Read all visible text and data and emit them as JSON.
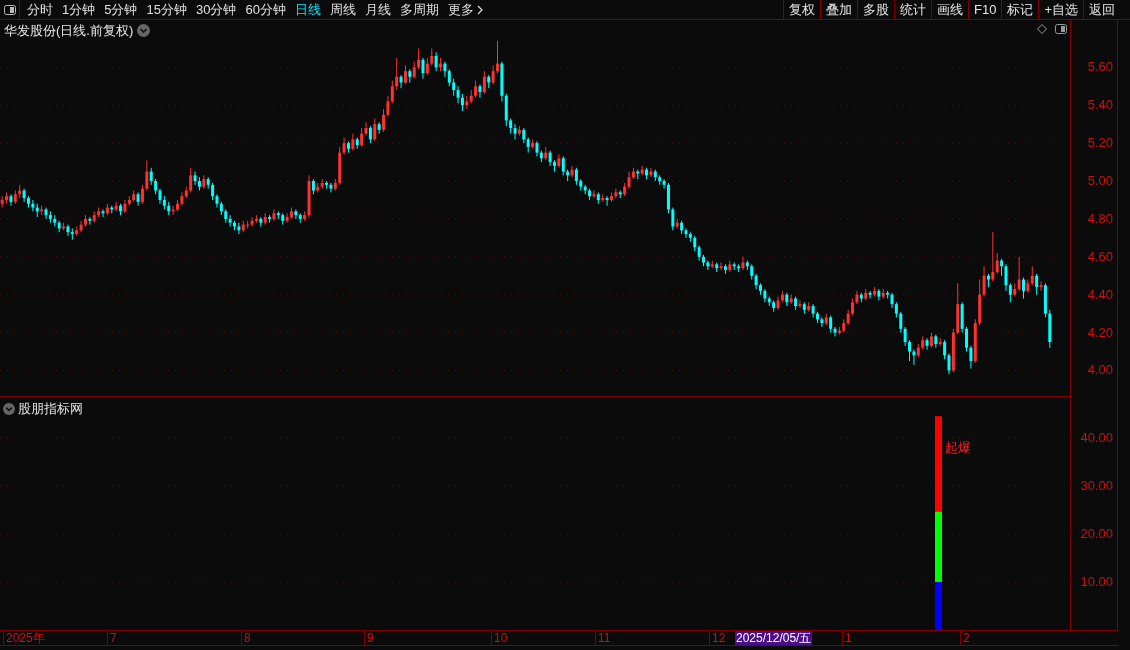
{
  "toolbar": {
    "periods": [
      {
        "label": "分时",
        "selected": false
      },
      {
        "label": "1分钟",
        "selected": false
      },
      {
        "label": "5分钟",
        "selected": false
      },
      {
        "label": "15分钟",
        "selected": false
      },
      {
        "label": "30分钟",
        "selected": false
      },
      {
        "label": "60分钟",
        "selected": false
      },
      {
        "label": "日线",
        "selected": true
      },
      {
        "label": "周线",
        "selected": false
      },
      {
        "label": "月线",
        "selected": false
      },
      {
        "label": "多周期",
        "selected": false
      },
      {
        "label": "更多",
        "selected": false
      }
    ],
    "buttons": [
      "复权",
      "叠加",
      "多股",
      "统计",
      "画线",
      "F10",
      "标记",
      "+自选",
      "返回"
    ]
  },
  "price_chart": {
    "title": "华发股份(日线.前复权)",
    "chart_data": {
      "type": "candlestick",
      "grid": true,
      "ylim": [
        3.86,
        5.85
      ],
      "yticks": [
        {
          "value": 5.6,
          "label": "5.60"
        },
        {
          "value": 5.4,
          "label": "5.40"
        },
        {
          "value": 5.2,
          "label": "5.20"
        },
        {
          "value": 5.0,
          "label": "5.00"
        },
        {
          "value": 4.8,
          "label": "4.80"
        },
        {
          "value": 4.6,
          "label": "4.60"
        },
        {
          "value": 4.4,
          "label": "4.40"
        },
        {
          "value": 4.2,
          "label": "4.20"
        },
        {
          "value": 4.0,
          "label": "4.00"
        }
      ],
      "categories": [
        null,
        null,
        null,
        null,
        null,
        null,
        null,
        null,
        null,
        null,
        null,
        null,
        null,
        null,
        null,
        null,
        null,
        null,
        null,
        null,
        null,
        null,
        null,
        null,
        null,
        null,
        null,
        null,
        null,
        null,
        null,
        null,
        null,
        null,
        null,
        null,
        null,
        null,
        null,
        null,
        null,
        null,
        null,
        null,
        null,
        null,
        null,
        null,
        null,
        null,
        null,
        null,
        null,
        null,
        null,
        null,
        null,
        null,
        null,
        null,
        null,
        null,
        null,
        null,
        null,
        null,
        null,
        null,
        null,
        null,
        null,
        null,
        null,
        null,
        null,
        null,
        null,
        null,
        null,
        null,
        null,
        null,
        null,
        null,
        null,
        null,
        null,
        null,
        null,
        null,
        null,
        null,
        null,
        null,
        null,
        null,
        null,
        null,
        null,
        null,
        null,
        null,
        null,
        null,
        null,
        null,
        null,
        null,
        null,
        null,
        null,
        null,
        null,
        null,
        null,
        null,
        null,
        null,
        null,
        null,
        null,
        null,
        null,
        null,
        null,
        null,
        null,
        null,
        null,
        null,
        null,
        null,
        null,
        null,
        null,
        null,
        null,
        null,
        null,
        null,
        null,
        null,
        null,
        null,
        null,
        null,
        null,
        null,
        null,
        null,
        null,
        null,
        null,
        null,
        null,
        null,
        null,
        null,
        null,
        null,
        null,
        null,
        null,
        null,
        null,
        null,
        null,
        null,
        null,
        null,
        null,
        null,
        null,
        null,
        null,
        null,
        null,
        null,
        null,
        null,
        null,
        null,
        null,
        null,
        null,
        null,
        null,
        null,
        null,
        null,
        null,
        null,
        null,
        null,
        null,
        null,
        null,
        null,
        null,
        null,
        null,
        null,
        null,
        null,
        null,
        null,
        null,
        null,
        null,
        null,
        null,
        null,
        null,
        null,
        null,
        null,
        null,
        null,
        null,
        null,
        null,
        null,
        null,
        null,
        null,
        null,
        null,
        null,
        null,
        null,
        null,
        null,
        null,
        null,
        null,
        null,
        null,
        null,
        null,
        null
      ],
      "ohlc": [
        [
          4.88,
          4.92,
          4.86,
          4.9
        ],
        [
          4.9,
          4.94,
          4.88,
          4.92
        ],
        [
          4.92,
          4.93,
          4.87,
          4.89
        ],
        [
          4.89,
          4.95,
          4.88,
          4.93
        ],
        [
          4.93,
          4.98,
          4.91,
          4.95
        ],
        [
          4.95,
          4.96,
          4.89,
          4.91
        ],
        [
          4.91,
          4.92,
          4.86,
          4.88
        ],
        [
          4.88,
          4.9,
          4.84,
          4.86
        ],
        [
          4.86,
          4.88,
          4.81,
          4.84
        ],
        [
          4.84,
          4.87,
          4.82,
          4.85
        ],
        [
          4.85,
          4.86,
          4.8,
          4.82
        ],
        [
          4.82,
          4.84,
          4.78,
          4.8
        ],
        [
          4.8,
          4.82,
          4.76,
          4.78
        ],
        [
          4.78,
          4.79,
          4.73,
          4.75
        ],
        [
          4.75,
          4.78,
          4.74,
          4.76
        ],
        [
          4.76,
          4.77,
          4.71,
          4.73
        ],
        [
          4.73,
          4.75,
          4.69,
          4.72
        ],
        [
          4.72,
          4.76,
          4.71,
          4.74
        ],
        [
          4.74,
          4.79,
          4.73,
          4.77
        ],
        [
          4.77,
          4.82,
          4.76,
          4.8
        ],
        [
          4.8,
          4.81,
          4.77,
          4.79
        ],
        [
          4.79,
          4.84,
          4.78,
          4.82
        ],
        [
          4.82,
          4.86,
          4.81,
          4.84
        ],
        [
          4.84,
          4.85,
          4.81,
          4.83
        ],
        [
          4.83,
          4.88,
          4.82,
          4.86
        ],
        [
          4.86,
          4.87,
          4.83,
          4.85
        ],
        [
          4.85,
          4.89,
          4.84,
          4.87
        ],
        [
          4.87,
          4.88,
          4.82,
          4.84
        ],
        [
          4.84,
          4.9,
          4.83,
          4.88
        ],
        [
          4.88,
          4.92,
          4.87,
          4.9
        ],
        [
          4.9,
          4.95,
          4.89,
          4.93
        ],
        [
          4.93,
          4.94,
          4.87,
          4.89
        ],
        [
          4.89,
          4.98,
          4.88,
          4.96
        ],
        [
          4.96,
          5.11,
          4.95,
          5.05
        ],
        [
          5.05,
          5.07,
          4.98,
          5.0
        ],
        [
          5.0,
          5.01,
          4.93,
          4.95
        ],
        [
          4.95,
          4.96,
          4.88,
          4.9
        ],
        [
          4.9,
          4.92,
          4.85,
          4.87
        ],
        [
          4.87,
          4.89,
          4.82,
          4.84
        ],
        [
          4.84,
          4.87,
          4.82,
          4.85
        ],
        [
          4.85,
          4.9,
          4.84,
          4.88
        ],
        [
          4.88,
          4.94,
          4.87,
          4.92
        ],
        [
          4.92,
          4.97,
          4.91,
          4.95
        ],
        [
          4.95,
          5.07,
          4.94,
          5.03
        ],
        [
          5.03,
          5.05,
          4.98,
          5.0
        ],
        [
          5.0,
          5.02,
          4.95,
          4.97
        ],
        [
          4.97,
          5.03,
          4.96,
          5.01
        ],
        [
          5.01,
          5.02,
          4.96,
          4.98
        ],
        [
          4.98,
          4.99,
          4.9,
          4.92
        ],
        [
          4.92,
          4.93,
          4.86,
          4.88
        ],
        [
          4.88,
          4.89,
          4.82,
          4.84
        ],
        [
          4.84,
          4.85,
          4.78,
          4.8
        ],
        [
          4.8,
          4.82,
          4.76,
          4.78
        ],
        [
          4.78,
          4.79,
          4.74,
          4.76
        ],
        [
          4.76,
          4.78,
          4.72,
          4.74
        ],
        [
          4.74,
          4.79,
          4.73,
          4.77
        ],
        [
          4.77,
          4.79,
          4.75,
          4.77
        ],
        [
          4.77,
          4.81,
          4.76,
          4.79
        ],
        [
          4.79,
          4.82,
          4.78,
          4.8
        ],
        [
          4.8,
          4.81,
          4.76,
          4.78
        ],
        [
          4.78,
          4.83,
          4.77,
          4.81
        ],
        [
          4.81,
          4.82,
          4.78,
          4.8
        ],
        [
          4.8,
          4.85,
          4.79,
          4.83
        ],
        [
          4.83,
          4.84,
          4.8,
          4.82
        ],
        [
          4.82,
          4.83,
          4.77,
          4.79
        ],
        [
          4.79,
          4.83,
          4.78,
          4.81
        ],
        [
          4.81,
          4.86,
          4.8,
          4.84
        ],
        [
          4.84,
          4.85,
          4.8,
          4.82
        ],
        [
          4.82,
          4.83,
          4.78,
          4.8
        ],
        [
          4.8,
          4.84,
          4.79,
          4.82
        ],
        [
          4.82,
          5.03,
          4.81,
          5.0
        ],
        [
          5.0,
          5.01,
          4.93,
          4.95
        ],
        [
          4.95,
          4.99,
          4.94,
          4.97
        ],
        [
          4.97,
          5.01,
          4.96,
          4.99
        ],
        [
          4.99,
          5.0,
          4.96,
          4.98
        ],
        [
          4.98,
          4.99,
          4.94,
          4.96
        ],
        [
          4.96,
          5.01,
          4.95,
          4.99
        ],
        [
          4.99,
          5.18,
          4.98,
          5.15
        ],
        [
          5.15,
          5.23,
          5.14,
          5.2
        ],
        [
          5.2,
          5.21,
          5.15,
          5.17
        ],
        [
          5.17,
          5.25,
          5.16,
          5.22
        ],
        [
          5.22,
          5.23,
          5.17,
          5.19
        ],
        [
          5.19,
          5.28,
          5.18,
          5.25
        ],
        [
          5.25,
          5.31,
          5.24,
          5.28
        ],
        [
          5.28,
          5.29,
          5.2,
          5.22
        ],
        [
          5.22,
          5.33,
          5.21,
          5.3
        ],
        [
          5.3,
          5.31,
          5.25,
          5.27
        ],
        [
          5.27,
          5.38,
          5.26,
          5.35
        ],
        [
          5.35,
          5.45,
          5.34,
          5.42
        ],
        [
          5.42,
          5.53,
          5.41,
          5.5
        ],
        [
          5.5,
          5.65,
          5.48,
          5.55
        ],
        [
          5.55,
          5.56,
          5.49,
          5.52
        ],
        [
          5.52,
          5.61,
          5.51,
          5.58
        ],
        [
          5.58,
          5.59,
          5.52,
          5.55
        ],
        [
          5.55,
          5.63,
          5.54,
          5.6
        ],
        [
          5.6,
          5.7,
          5.59,
          5.64
        ],
        [
          5.64,
          5.65,
          5.54,
          5.57
        ],
        [
          5.57,
          5.65,
          5.56,
          5.62
        ],
        [
          5.62,
          5.7,
          5.61,
          5.66
        ],
        [
          5.66,
          5.68,
          5.58,
          5.6
        ],
        [
          5.6,
          5.65,
          5.58,
          5.62
        ],
        [
          5.62,
          5.63,
          5.55,
          5.58
        ],
        [
          5.58,
          5.59,
          5.5,
          5.52
        ],
        [
          5.52,
          5.54,
          5.45,
          5.48
        ],
        [
          5.48,
          5.5,
          5.41,
          5.44
        ],
        [
          5.44,
          5.46,
          5.37,
          5.4
        ],
        [
          5.4,
          5.45,
          5.38,
          5.42
        ],
        [
          5.42,
          5.48,
          5.41,
          5.45
        ],
        [
          5.45,
          5.53,
          5.44,
          5.5
        ],
        [
          5.5,
          5.51,
          5.44,
          5.47
        ],
        [
          5.47,
          5.58,
          5.46,
          5.55
        ],
        [
          5.55,
          5.56,
          5.49,
          5.52
        ],
        [
          5.52,
          5.61,
          5.51,
          5.58
        ],
        [
          5.58,
          5.74,
          5.57,
          5.62
        ],
        [
          5.62,
          5.63,
          5.42,
          5.45
        ],
        [
          5.45,
          5.46,
          5.29,
          5.32
        ],
        [
          5.32,
          5.33,
          5.25,
          5.28
        ],
        [
          5.28,
          5.3,
          5.22,
          5.25
        ],
        [
          5.25,
          5.29,
          5.24,
          5.27
        ],
        [
          5.27,
          5.28,
          5.2,
          5.22
        ],
        [
          5.22,
          5.23,
          5.15,
          5.18
        ],
        [
          5.18,
          5.22,
          5.17,
          5.2
        ],
        [
          5.2,
          5.21,
          5.13,
          5.15
        ],
        [
          5.15,
          5.16,
          5.1,
          5.12
        ],
        [
          5.12,
          5.18,
          5.11,
          5.15
        ],
        [
          5.15,
          5.16,
          5.08,
          5.1
        ],
        [
          5.1,
          5.11,
          5.05,
          5.08
        ],
        [
          5.08,
          5.14,
          5.07,
          5.12
        ],
        [
          5.12,
          5.13,
          5.03,
          5.05
        ],
        [
          5.05,
          5.06,
          5.0,
          5.03
        ],
        [
          5.03,
          5.08,
          5.02,
          5.06
        ],
        [
          5.06,
          5.07,
          4.98,
          5.0
        ],
        [
          5.0,
          5.01,
          4.95,
          4.97
        ],
        [
          4.97,
          4.98,
          4.93,
          4.95
        ],
        [
          4.95,
          4.96,
          4.9,
          4.92
        ],
        [
          4.92,
          4.95,
          4.91,
          4.93
        ],
        [
          4.93,
          4.94,
          4.88,
          4.9
        ],
        [
          4.9,
          4.93,
          4.89,
          4.91
        ],
        [
          4.91,
          4.92,
          4.87,
          4.9
        ],
        [
          4.9,
          4.94,
          4.89,
          4.92
        ],
        [
          4.92,
          4.96,
          4.91,
          4.94
        ],
        [
          4.94,
          4.95,
          4.91,
          4.93
        ],
        [
          4.93,
          4.99,
          4.92,
          4.97
        ],
        [
          4.97,
          5.05,
          4.96,
          5.02
        ],
        [
          5.02,
          5.07,
          5.01,
          5.05
        ],
        [
          5.05,
          5.06,
          5.01,
          5.04
        ],
        [
          5.04,
          5.08,
          5.03,
          5.06
        ],
        [
          5.06,
          5.07,
          5.01,
          5.03
        ],
        [
          5.03,
          5.07,
          5.02,
          5.05
        ],
        [
          5.05,
          5.06,
          5.0,
          5.02
        ],
        [
          5.02,
          5.03,
          4.98,
          5.0
        ],
        [
          5.0,
          5.01,
          4.96,
          4.98
        ],
        [
          4.98,
          4.99,
          4.83,
          4.85
        ],
        [
          4.85,
          4.86,
          4.74,
          4.76
        ],
        [
          4.76,
          4.8,
          4.75,
          4.78
        ],
        [
          4.78,
          4.79,
          4.72,
          4.74
        ],
        [
          4.74,
          4.75,
          4.7,
          4.72
        ],
        [
          4.72,
          4.73,
          4.68,
          4.7
        ],
        [
          4.7,
          4.71,
          4.63,
          4.65
        ],
        [
          4.65,
          4.66,
          4.58,
          4.6
        ],
        [
          4.6,
          4.61,
          4.55,
          4.57
        ],
        [
          4.57,
          4.58,
          4.53,
          4.55
        ],
        [
          4.55,
          4.58,
          4.54,
          4.56
        ],
        [
          4.56,
          4.57,
          4.52,
          4.54
        ],
        [
          4.54,
          4.57,
          4.53,
          4.55
        ],
        [
          4.55,
          4.56,
          4.51,
          4.53
        ],
        [
          4.53,
          4.58,
          4.52,
          4.56
        ],
        [
          4.56,
          4.57,
          4.53,
          4.55
        ],
        [
          4.55,
          4.56,
          4.52,
          4.54
        ],
        [
          4.54,
          4.6,
          4.53,
          4.57
        ],
        [
          4.57,
          4.58,
          4.53,
          4.55
        ],
        [
          4.55,
          4.56,
          4.48,
          4.5
        ],
        [
          4.5,
          4.51,
          4.43,
          4.45
        ],
        [
          4.45,
          4.46,
          4.4,
          4.42
        ],
        [
          4.42,
          4.43,
          4.36,
          4.38
        ],
        [
          4.38,
          4.39,
          4.34,
          4.36
        ],
        [
          4.36,
          4.37,
          4.31,
          4.33
        ],
        [
          4.33,
          4.39,
          4.32,
          4.37
        ],
        [
          4.37,
          4.42,
          4.36,
          4.4
        ],
        [
          4.4,
          4.41,
          4.34,
          4.36
        ],
        [
          4.36,
          4.4,
          4.35,
          4.38
        ],
        [
          4.38,
          4.39,
          4.32,
          4.34
        ],
        [
          4.34,
          4.37,
          4.33,
          4.35
        ],
        [
          4.35,
          4.36,
          4.3,
          4.32
        ],
        [
          4.32,
          4.36,
          4.31,
          4.34
        ],
        [
          4.34,
          4.35,
          4.28,
          4.3
        ],
        [
          4.3,
          4.31,
          4.25,
          4.27
        ],
        [
          4.27,
          4.28,
          4.23,
          4.25
        ],
        [
          4.25,
          4.3,
          4.24,
          4.28
        ],
        [
          4.28,
          4.29,
          4.2,
          4.22
        ],
        [
          4.22,
          4.23,
          4.18,
          4.2
        ],
        [
          4.2,
          4.23,
          4.19,
          4.21
        ],
        [
          4.21,
          4.27,
          4.2,
          4.25
        ],
        [
          4.25,
          4.32,
          4.24,
          4.3
        ],
        [
          4.3,
          4.38,
          4.29,
          4.36
        ],
        [
          4.36,
          4.42,
          4.35,
          4.4
        ],
        [
          4.4,
          4.41,
          4.36,
          4.38
        ],
        [
          4.38,
          4.43,
          4.37,
          4.41
        ],
        [
          4.41,
          4.42,
          4.38,
          4.4
        ],
        [
          4.4,
          4.44,
          4.39,
          4.42
        ],
        [
          4.42,
          4.43,
          4.37,
          4.39
        ],
        [
          4.39,
          4.43,
          4.38,
          4.41
        ],
        [
          4.41,
          4.42,
          4.38,
          4.4
        ],
        [
          4.4,
          4.41,
          4.33,
          4.35
        ],
        [
          4.35,
          4.36,
          4.28,
          4.3
        ],
        [
          4.3,
          4.31,
          4.2,
          4.22
        ],
        [
          4.22,
          4.23,
          4.13,
          4.15
        ],
        [
          4.15,
          4.16,
          4.05,
          4.1
        ],
        [
          4.1,
          4.11,
          4.03,
          4.08
        ],
        [
          4.08,
          4.14,
          4.07,
          4.12
        ],
        [
          4.12,
          4.18,
          4.11,
          4.16
        ],
        [
          4.16,
          4.17,
          4.11,
          4.13
        ],
        [
          4.13,
          4.2,
          4.12,
          4.18
        ],
        [
          4.18,
          4.19,
          4.12,
          4.14
        ],
        [
          4.14,
          4.17,
          4.13,
          4.15
        ],
        [
          4.15,
          4.16,
          4.06,
          4.08
        ],
        [
          4.08,
          4.09,
          3.98,
          4.0
        ],
        [
          4.0,
          4.22,
          3.99,
          4.2
        ],
        [
          4.2,
          4.46,
          4.19,
          4.35
        ],
        [
          4.35,
          4.36,
          4.2,
          4.22
        ],
        [
          4.22,
          4.23,
          4.1,
          4.12
        ],
        [
          4.12,
          4.13,
          4.01,
          4.05
        ],
        [
          4.05,
          4.27,
          4.04,
          4.25
        ],
        [
          4.25,
          4.48,
          4.24,
          4.4
        ],
        [
          4.4,
          4.55,
          4.39,
          4.5
        ],
        [
          4.5,
          4.51,
          4.44,
          4.48
        ],
        [
          4.48,
          4.73,
          4.47,
          4.52
        ],
        [
          4.52,
          4.62,
          4.51,
          4.58
        ],
        [
          4.58,
          4.59,
          4.5,
          4.55
        ],
        [
          4.55,
          4.56,
          4.42,
          4.45
        ],
        [
          4.45,
          4.46,
          4.36,
          4.4
        ],
        [
          4.4,
          4.46,
          4.39,
          4.43
        ],
        [
          4.43,
          4.6,
          4.42,
          4.48
        ],
        [
          4.48,
          4.49,
          4.38,
          4.42
        ],
        [
          4.42,
          4.48,
          4.41,
          4.46
        ],
        [
          4.46,
          4.55,
          4.45,
          4.5
        ],
        [
          4.5,
          4.51,
          4.4,
          4.44
        ],
        [
          4.44,
          4.47,
          4.42,
          4.45
        ],
        [
          4.45,
          4.46,
          4.28,
          4.3
        ],
        [
          4.3,
          4.32,
          4.12,
          4.15
        ]
      ]
    }
  },
  "indicator": {
    "title": "股朋指标网",
    "chart_data": {
      "type": "bar",
      "stacked": true,
      "grid": true,
      "ylim": [
        0,
        48.5
      ],
      "yticks": [
        {
          "value": 40,
          "label": "40.00"
        },
        {
          "value": 30,
          "label": "30.00"
        },
        {
          "value": 20,
          "label": "20.00"
        },
        {
          "value": 10,
          "label": "10.00"
        }
      ],
      "series": [
        {
          "color": "#0000ff",
          "values": [
            10
          ]
        },
        {
          "color": "#00ff00",
          "values": [
            14.7
          ]
        },
        {
          "color": "#ff0000",
          "values": [
            19.8
          ]
        }
      ],
      "annotations": [
        {
          "text": "起爆"
        }
      ]
    }
  },
  "time_axis": {
    "labels": [
      {
        "text": "2025年",
        "selected": false
      },
      {
        "text": "7",
        "selected": false
      },
      {
        "text": "8",
        "selected": false
      },
      {
        "text": "9",
        "selected": false
      },
      {
        "text": "10",
        "selected": false
      },
      {
        "text": "11",
        "selected": false
      },
      {
        "text": "12",
        "selected": false
      },
      {
        "text": "2025/12/05/五",
        "selected": true
      },
      {
        "text": "1",
        "selected": false
      },
      {
        "text": "2",
        "selected": false
      }
    ]
  }
}
